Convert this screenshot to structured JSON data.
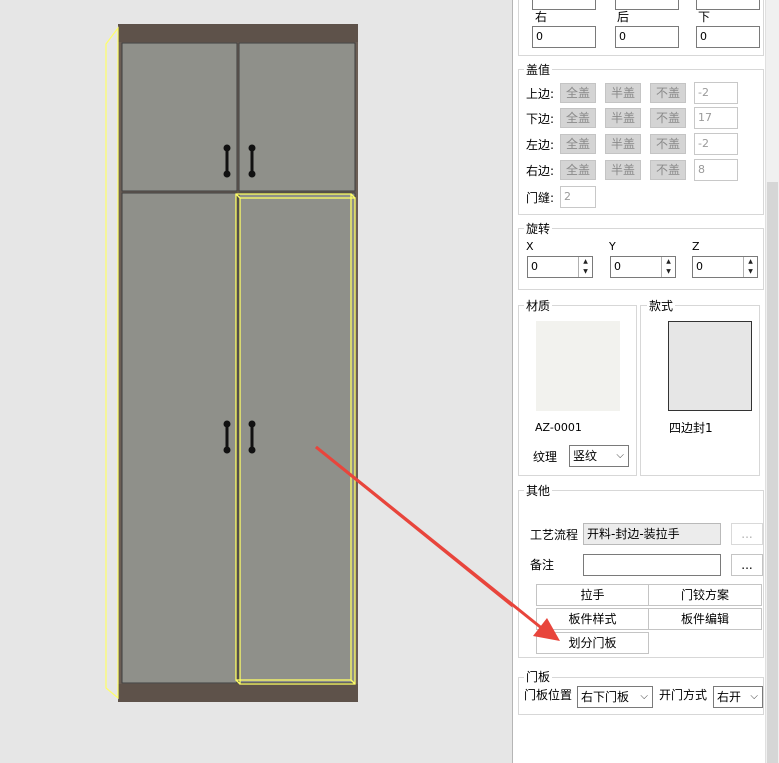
{
  "position": {
    "right_label": "右",
    "right_value": "0",
    "back_label": "后",
    "back_value": "0",
    "down_label": "下",
    "down_value": "0"
  },
  "cover": {
    "title": "盖值",
    "rows": [
      {
        "label": "上边:",
        "opt1": "全盖",
        "opt2": "半盖",
        "opt3": "不盖",
        "value": "-2"
      },
      {
        "label": "下边:",
        "opt1": "全盖",
        "opt2": "半盖",
        "opt3": "不盖",
        "value": "17"
      },
      {
        "label": "左边:",
        "opt1": "全盖",
        "opt2": "半盖",
        "opt3": "不盖",
        "value": "-2"
      },
      {
        "label": "右边:",
        "opt1": "全盖",
        "opt2": "半盖",
        "opt3": "不盖",
        "value": "8"
      }
    ],
    "gap_label": "门缝:",
    "gap_value": "2"
  },
  "rotation": {
    "title": "旋转",
    "x_label": "X",
    "x_value": "0",
    "y_label": "Y",
    "y_value": "0",
    "z_label": "Z",
    "z_value": "0"
  },
  "material": {
    "title": "材质",
    "code": "AZ-0001",
    "grain_label": "纹理",
    "grain_value": "竖纹",
    "swatch_color": "#f2f2ee"
  },
  "style": {
    "title": "款式",
    "name": "四边封1",
    "swatch_color": "#e6e6e6"
  },
  "other": {
    "title": "其他",
    "process_label": "工艺流程",
    "process_value": "开料-封边-装拉手",
    "process_btn": "...",
    "note_label": "备注",
    "note_value": "",
    "note_btn": "...",
    "btn_handle": "拉手",
    "btn_hinge": "门铰方案",
    "btn_panel_style": "板件样式",
    "btn_panel_edit": "板件编辑",
    "btn_split": "划分门板"
  },
  "door": {
    "title": "门板",
    "position_label": "门板位置",
    "position_value": "右下门板",
    "open_label": "开门方式",
    "open_value": "右开"
  },
  "colors": {
    "cabinet_frame": "#6b5e55",
    "door_face": "#8f908a",
    "selection": "#ffff66",
    "arrow": "#e8453c"
  }
}
